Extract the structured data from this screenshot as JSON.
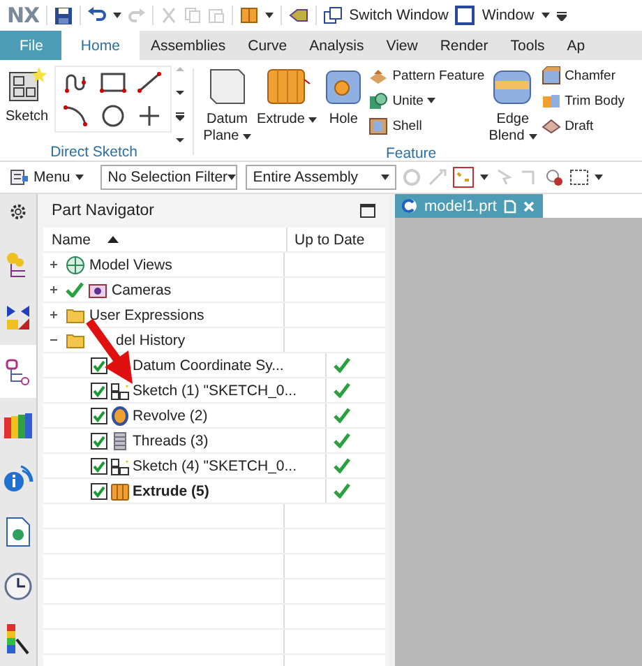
{
  "quick_access": {
    "logo": "NX",
    "switch_window": "Switch Window",
    "window_menu": "Window"
  },
  "ribbon_tabs": [
    {
      "label": "File",
      "kind": "file",
      "selected": false
    },
    {
      "label": "Home",
      "kind": "tab",
      "selected": true
    },
    {
      "label": "Assemblies",
      "kind": "tab",
      "selected": false
    },
    {
      "label": "Curve",
      "kind": "tab",
      "selected": false
    },
    {
      "label": "Analysis",
      "kind": "tab",
      "selected": false
    },
    {
      "label": "View",
      "kind": "tab",
      "selected": false
    },
    {
      "label": "Render",
      "kind": "tab",
      "selected": false
    },
    {
      "label": "Tools",
      "kind": "tab",
      "selected": false
    },
    {
      "label": "Ap",
      "kind": "tab",
      "selected": false
    }
  ],
  "direct_sketch": {
    "title": "Direct Sketch",
    "sketch_label": "Sketch"
  },
  "feature": {
    "title": "Feature",
    "columns": [
      {
        "kind": "large",
        "label": "Datum\nPlane",
        "dropdown": true
      },
      {
        "kind": "large",
        "label": "Extrude",
        "dropdown": true
      },
      {
        "kind": "large",
        "label": "Hole",
        "dropdown": false
      },
      {
        "kind": "stack",
        "items": [
          {
            "label": "Pattern Feature",
            "dropdown": false
          },
          {
            "label": "Unite",
            "dropdown": true
          },
          {
            "label": "Shell",
            "dropdown": false
          }
        ]
      },
      {
        "kind": "large",
        "label": "Edge\nBlend",
        "dropdown": true
      },
      {
        "kind": "stack",
        "items": [
          {
            "label": "Chamfer",
            "dropdown": false
          },
          {
            "label": "Trim Body",
            "dropdown": false
          },
          {
            "label": "Draft",
            "dropdown": false
          }
        ]
      }
    ]
  },
  "toolbar": {
    "menu": "Menu",
    "selection_filter": "No Selection Filter",
    "scope": "Entire Assembly"
  },
  "resource_bar": [
    {
      "kind": "assembly",
      "selected": false
    },
    {
      "kind": "constraint",
      "selected": false
    },
    {
      "kind": "part",
      "selected": true
    },
    {
      "kind": "library",
      "selected": false
    },
    {
      "kind": "info",
      "selected": false
    },
    {
      "kind": "document",
      "selected": false
    },
    {
      "kind": "history",
      "selected": false
    },
    {
      "kind": "palette",
      "selected": false
    }
  ],
  "part_navigator": {
    "title": "Part Navigator",
    "columns": [
      "Name",
      "Up to Date"
    ],
    "nodes": [
      {
        "label": "Model Views",
        "kind": "views",
        "expanded": false,
        "checked": false
      },
      {
        "label": "Cameras",
        "kind": "cameras",
        "expanded": false,
        "checked": true
      },
      {
        "label": "User Expressions",
        "kind": "folder",
        "expanded": false,
        "checked": false
      },
      {
        "label": "del History",
        "kind": "folder",
        "expanded": true,
        "checked": false,
        "children": [
          {
            "label": "Datum Coordinate Sy...",
            "kind": "datum",
            "checked": true,
            "up_to_date": true,
            "current": false
          },
          {
            "label": "Sketch (1) \"SKETCH_0...",
            "kind": "sketch",
            "checked": true,
            "up_to_date": true,
            "current": false
          },
          {
            "label": "Revolve (2)",
            "kind": "revolve",
            "checked": true,
            "up_to_date": true,
            "current": false
          },
          {
            "label": "Threads (3)",
            "kind": "threads",
            "checked": true,
            "up_to_date": true,
            "current": false
          },
          {
            "label": "Sketch (4) \"SKETCH_0...",
            "kind": "sketch",
            "checked": true,
            "up_to_date": true,
            "current": false
          },
          {
            "label": "Extrude (5)",
            "kind": "extrude",
            "checked": true,
            "up_to_date": true,
            "current": true
          }
        ]
      }
    ]
  },
  "graphics": {
    "tab": "model1.prt"
  }
}
